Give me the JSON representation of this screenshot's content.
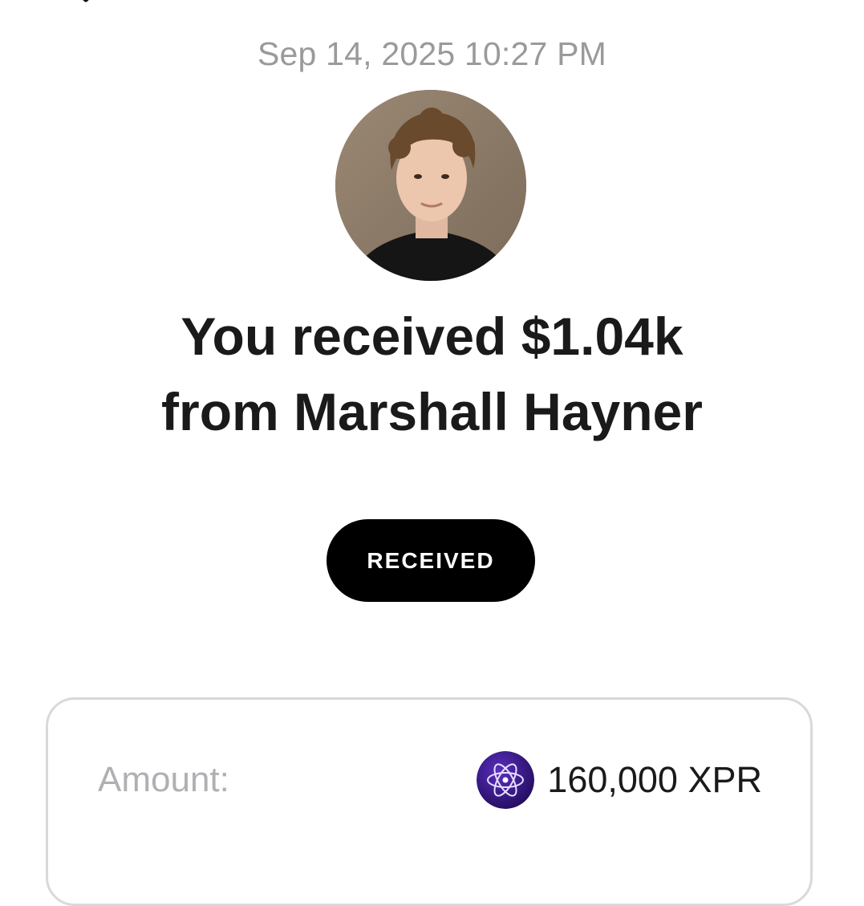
{
  "header": {
    "close_icon": "close-icon"
  },
  "transaction": {
    "timestamp": "Sep 14, 2025 10:27 PM",
    "headline_line1": "You received $1.04k",
    "headline_line2": "from Marshall Hayner",
    "status": "RECEIVED"
  },
  "details": {
    "amount_label": "Amount:",
    "amount_value": "160,000 XPR",
    "token_icon": "xpr-token-icon"
  },
  "colors": {
    "status_pill_bg": "#000000",
    "token_icon_bg": "#3b1a8a"
  }
}
